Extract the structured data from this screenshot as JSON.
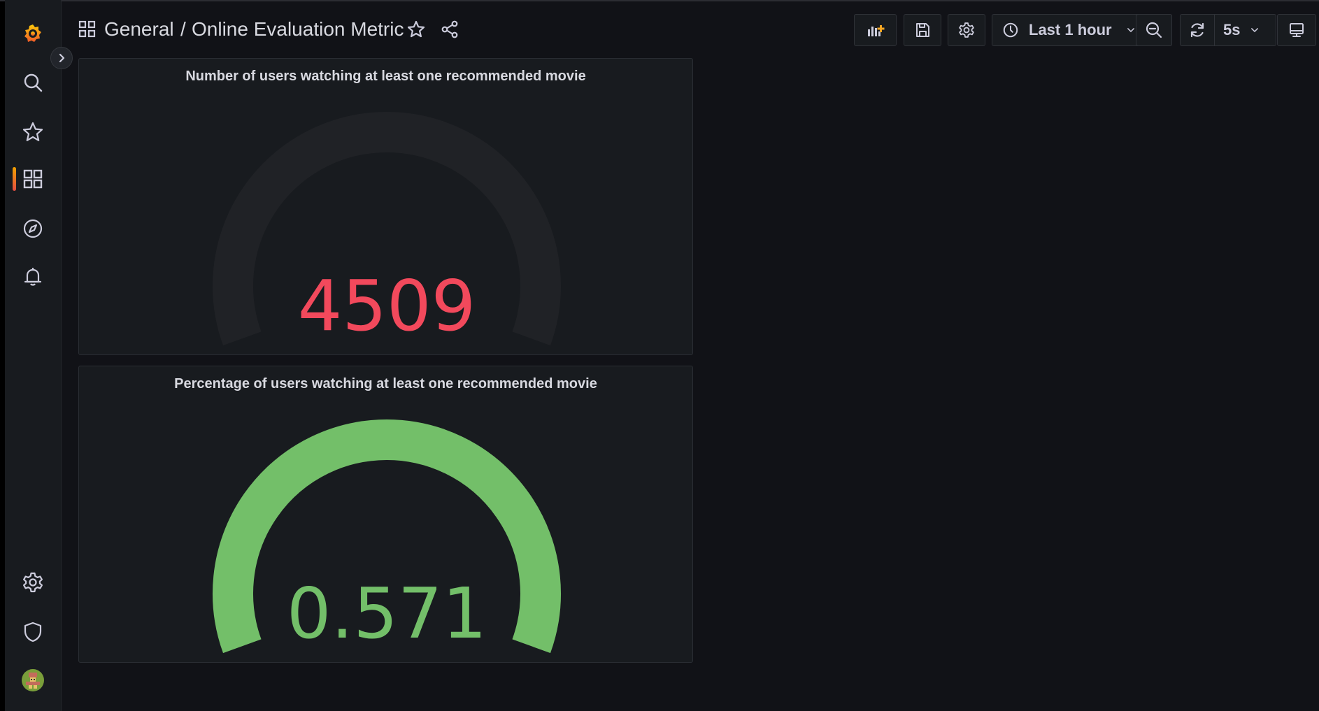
{
  "breadcrumb": {
    "folder": "General",
    "separator": "/",
    "dashboard_title": "Online Evaluation Metric"
  },
  "toolbar": {
    "time_range_label": "Last 1 hour",
    "refresh_interval_label": "5s"
  },
  "panels": [
    {
      "title": "Number of users watching at least one recommended movie",
      "value": "4509",
      "value_color": "#f2495c",
      "gauge_fill_fraction": 0,
      "gauge_fill_color": "#73bf69"
    },
    {
      "title": "Percentage of users watching at least one recommended movie",
      "value": "0.571",
      "value_color": "#73bf69",
      "gauge_fill_fraction": 1,
      "gauge_fill_color": "#73bf69"
    }
  ],
  "colors": {
    "background": "#111217",
    "panel_background": "#181b1f",
    "gauge_track": "#202226",
    "threshold_red": "#f2495c",
    "threshold_green": "#73bf69",
    "brand_orange": "#f46800"
  },
  "icons": {
    "sidebar": [
      "grafana-logo-icon",
      "search-icon",
      "star-icon",
      "dashboards-icon",
      "explore-icon",
      "alerting-icon",
      "configuration-icon",
      "shield-icon",
      "user-avatar-icon"
    ],
    "toolbar": [
      "add-panel-icon",
      "save-icon",
      "settings-icon",
      "clock-icon",
      "chevron-down-icon",
      "zoom-out-icon",
      "refresh-icon",
      "chevron-down-icon",
      "tv-mode-icon"
    ]
  }
}
